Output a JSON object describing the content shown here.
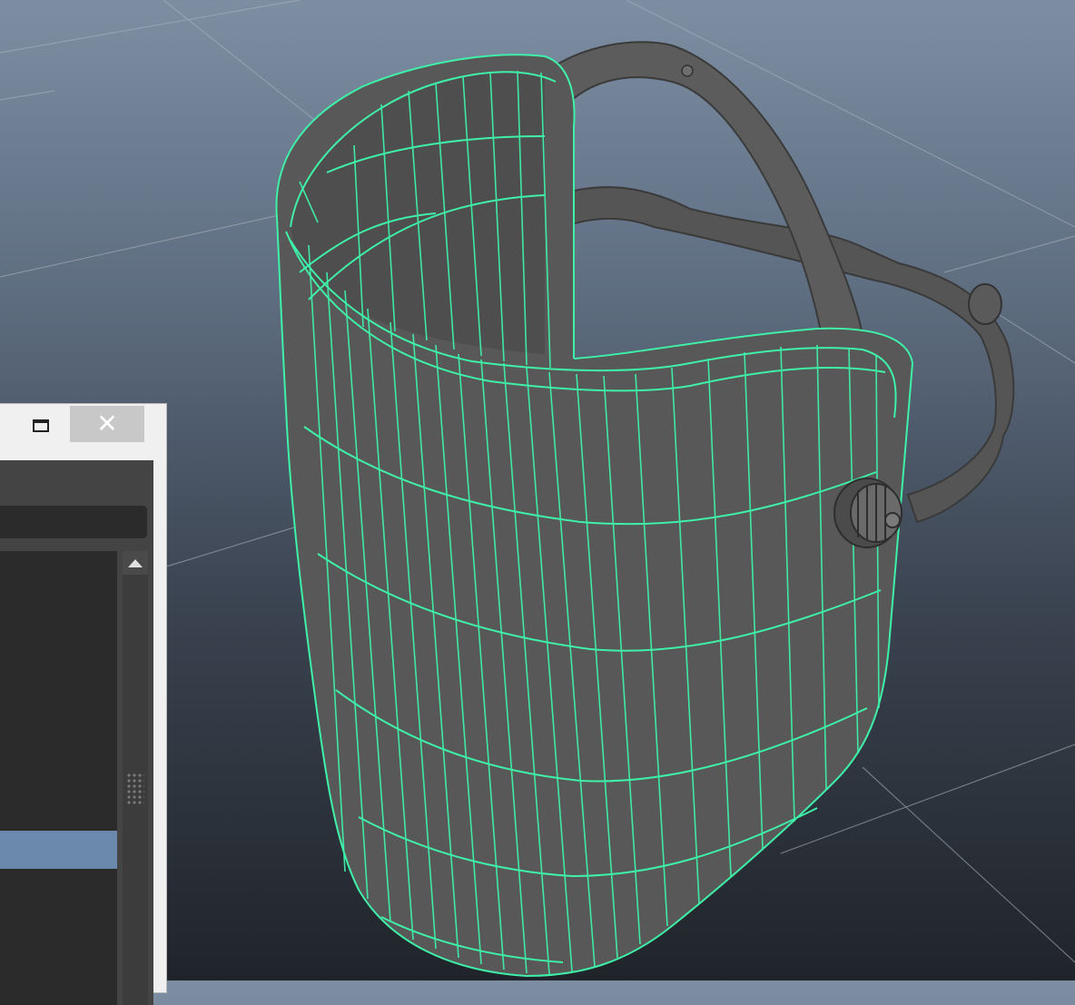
{
  "viewport": {
    "background_top": "#7d8ea3",
    "background_bottom": "#20242a",
    "grid_color": "#a9b3bf",
    "wireframe_color": "#3ff0a8",
    "mesh_color": "#5a5a5a",
    "strap_color": "#545454"
  },
  "window": {
    "maximize_icon": "window-maximize-icon",
    "close_label": "✕",
    "close_icon": "close-icon",
    "selected_row_color": "#6a89ad",
    "scroll_up_icon": "triangle-up-icon",
    "grip_icon": "drag-grip-icon"
  }
}
